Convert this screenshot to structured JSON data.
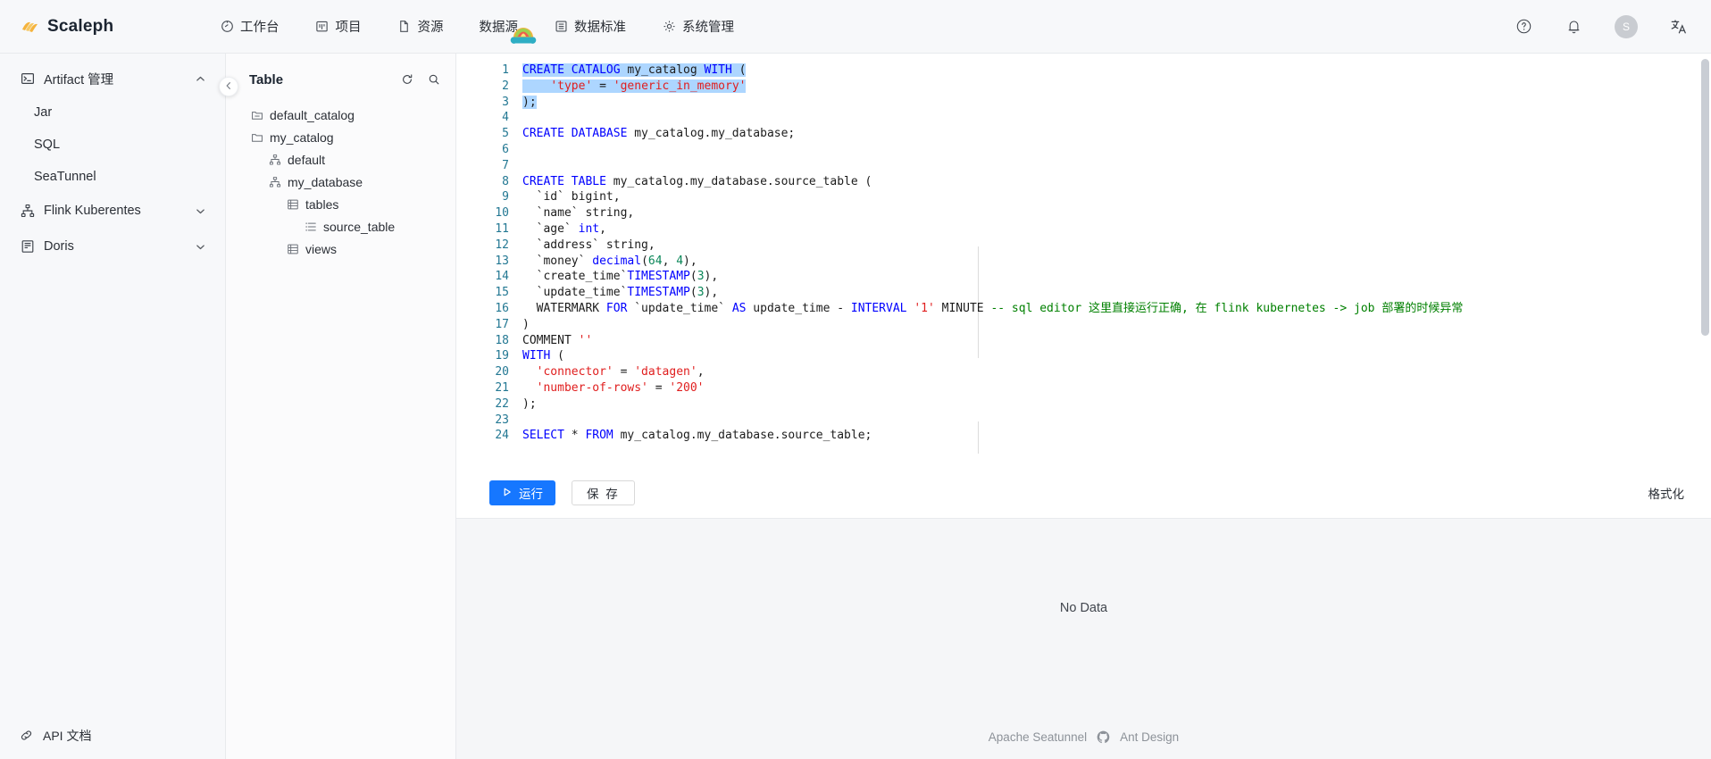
{
  "header": {
    "brand": "Scaleph",
    "brand_logo_icon": "scaleph-logo-icon",
    "nav": [
      {
        "label": "工作台",
        "icon": "dashboard-icon"
      },
      {
        "label": "项目",
        "icon": "project-icon"
      },
      {
        "label": "资源",
        "icon": "file-icon"
      },
      {
        "label": "数据源",
        "icon": ""
      },
      {
        "label": "数据标准",
        "icon": "standard-icon"
      },
      {
        "label": "系统管理",
        "icon": "gear-icon"
      }
    ],
    "actions": {
      "help_icon": "question-circle-icon",
      "bell_icon": "bell-icon",
      "avatar_text": "S",
      "translate_icon": "translate-icon"
    },
    "sticker_icon": "taco-emoji-sticker"
  },
  "sidebar": {
    "group": {
      "label": "Artifact 管理",
      "icon": "terminal-icon",
      "chevron": "chevron-up-icon",
      "expanded": true
    },
    "items": [
      {
        "label": "Jar"
      },
      {
        "label": "SQL"
      },
      {
        "label": "SeaTunnel"
      }
    ],
    "groups": [
      {
        "label": "Flink Kuberentes",
        "icon": "cluster-icon",
        "chevron": "chevron-down-icon"
      },
      {
        "label": "Doris",
        "icon": "database-doc-icon",
        "chevron": "chevron-down-icon"
      }
    ],
    "footer": {
      "label": "API 文档",
      "icon": "link-icon"
    },
    "collapse_icon": "chevron-left-icon"
  },
  "tree_panel": {
    "title": "Table",
    "refresh_icon": "refresh-icon",
    "search_icon": "search-icon",
    "nodes": [
      {
        "label": "default_catalog",
        "icon": "folder-collapsed-icon",
        "level": 1
      },
      {
        "label": "my_catalog",
        "icon": "folder-open-icon",
        "level": 1
      },
      {
        "label": "default",
        "icon": "schema-icon",
        "level": 2
      },
      {
        "label": "my_database",
        "icon": "schema-icon",
        "level": 2
      },
      {
        "label": "tables",
        "icon": "table-group-icon",
        "level": 3
      },
      {
        "label": "source_table",
        "icon": "table-icon",
        "level": 4
      },
      {
        "label": "views",
        "icon": "table-group-icon",
        "level": 3
      }
    ]
  },
  "editor": {
    "line_count": 24,
    "selection_lines": [
      1,
      2,
      3
    ],
    "lines": [
      {
        "n": 1,
        "tokens": [
          {
            "t": "CREATE CATALOG ",
            "c": "kw"
          },
          {
            "t": "my_catalog ",
            "c": "plain"
          },
          {
            "t": "WITH ",
            "c": "kw"
          },
          {
            "t": "(",
            "c": "plain"
          }
        ]
      },
      {
        "n": 2,
        "tokens": [
          {
            "t": "    ",
            "c": "plain"
          },
          {
            "t": "'type'",
            "c": "str"
          },
          {
            "t": " = ",
            "c": "op"
          },
          {
            "t": "'generic_in_memory'",
            "c": "str"
          }
        ]
      },
      {
        "n": 3,
        "tokens": [
          {
            "t": ");",
            "c": "plain"
          }
        ]
      },
      {
        "n": 4,
        "tokens": []
      },
      {
        "n": 5,
        "tokens": [
          {
            "t": "CREATE DATABASE ",
            "c": "kw"
          },
          {
            "t": "my_catalog.my_database;",
            "c": "plain"
          }
        ]
      },
      {
        "n": 6,
        "tokens": []
      },
      {
        "n": 7,
        "tokens": []
      },
      {
        "n": 8,
        "tokens": [
          {
            "t": "CREATE TABLE ",
            "c": "kw"
          },
          {
            "t": "my_catalog.my_database.source_table (",
            "c": "plain"
          }
        ]
      },
      {
        "n": 9,
        "tokens": [
          {
            "t": "  `id` bigint,",
            "c": "plain"
          }
        ]
      },
      {
        "n": 10,
        "tokens": [
          {
            "t": "  `name` string,",
            "c": "plain"
          }
        ]
      },
      {
        "n": 11,
        "tokens": [
          {
            "t": "  `age` ",
            "c": "plain"
          },
          {
            "t": "int",
            "c": "kw"
          },
          {
            "t": ",",
            "c": "plain"
          }
        ]
      },
      {
        "n": 12,
        "tokens": [
          {
            "t": "  `address` string,",
            "c": "plain"
          }
        ]
      },
      {
        "n": 13,
        "tokens": [
          {
            "t": "  `money` ",
            "c": "plain"
          },
          {
            "t": "decimal",
            "c": "kw"
          },
          {
            "t": "(",
            "c": "plain"
          },
          {
            "t": "64",
            "c": "num"
          },
          {
            "t": ", ",
            "c": "plain"
          },
          {
            "t": "4",
            "c": "num"
          },
          {
            "t": "),",
            "c": "plain"
          }
        ]
      },
      {
        "n": 14,
        "tokens": [
          {
            "t": "  `create_time`",
            "c": "plain"
          },
          {
            "t": "TIMESTAMP",
            "c": "kw"
          },
          {
            "t": "(",
            "c": "plain"
          },
          {
            "t": "3",
            "c": "num"
          },
          {
            "t": "),",
            "c": "plain"
          }
        ]
      },
      {
        "n": 15,
        "tokens": [
          {
            "t": "  `update_time`",
            "c": "plain"
          },
          {
            "t": "TIMESTAMP",
            "c": "kw"
          },
          {
            "t": "(",
            "c": "plain"
          },
          {
            "t": "3",
            "c": "num"
          },
          {
            "t": "),",
            "c": "plain"
          }
        ]
      },
      {
        "n": 16,
        "tokens": [
          {
            "t": "  WATERMARK ",
            "c": "plain"
          },
          {
            "t": "FOR ",
            "c": "kw"
          },
          {
            "t": "`update_time` ",
            "c": "plain"
          },
          {
            "t": "AS ",
            "c": "kw"
          },
          {
            "t": "update_time - ",
            "c": "plain"
          },
          {
            "t": "INTERVAL ",
            "c": "kw"
          },
          {
            "t": "'1'",
            "c": "str"
          },
          {
            "t": " MINUTE ",
            "c": "plain"
          },
          {
            "t": "-- sql editor 这里直接运行正确, 在 flink kubernetes -> job 部署的时候异常",
            "c": "cmt"
          }
        ]
      },
      {
        "n": 17,
        "tokens": [
          {
            "t": ")",
            "c": "plain"
          }
        ]
      },
      {
        "n": 18,
        "tokens": [
          {
            "t": "COMMENT ",
            "c": "plain"
          },
          {
            "t": "''",
            "c": "str"
          }
        ]
      },
      {
        "n": 19,
        "tokens": [
          {
            "t": "WITH ",
            "c": "kw"
          },
          {
            "t": "(",
            "c": "plain"
          }
        ]
      },
      {
        "n": 20,
        "tokens": [
          {
            "t": "  ",
            "c": "plain"
          },
          {
            "t": "'connector'",
            "c": "str"
          },
          {
            "t": " = ",
            "c": "op"
          },
          {
            "t": "'datagen'",
            "c": "str"
          },
          {
            "t": ",",
            "c": "plain"
          }
        ]
      },
      {
        "n": 21,
        "tokens": [
          {
            "t": "  ",
            "c": "plain"
          },
          {
            "t": "'number-of-rows'",
            "c": "str"
          },
          {
            "t": " = ",
            "c": "op"
          },
          {
            "t": "'200'",
            "c": "str"
          }
        ]
      },
      {
        "n": 22,
        "tokens": [
          {
            "t": ");",
            "c": "plain"
          }
        ]
      },
      {
        "n": 23,
        "tokens": []
      },
      {
        "n": 24,
        "tokens": [
          {
            "t": "SELECT ",
            "c": "kw"
          },
          {
            "t": "* ",
            "c": "op"
          },
          {
            "t": "FROM ",
            "c": "kw"
          },
          {
            "t": "my_catalog.my_database.source_table;",
            "c": "plain"
          }
        ]
      }
    ],
    "toolbar": {
      "run_label": "运行",
      "run_icon": "play-icon",
      "save_label": "保 存",
      "format_label": "格式化"
    }
  },
  "result": {
    "empty_text": "No Data"
  },
  "footer": {
    "left_label": "Apache Seatunnel",
    "github_icon": "github-icon",
    "right_label": "Ant Design"
  },
  "colors": {
    "accent": "#1677ff",
    "selection": "#add6ff",
    "keyword": "#0000ff",
    "string": "#e01e1e",
    "comment": "#008000",
    "number": "#098658",
    "gutter": "#237893"
  }
}
